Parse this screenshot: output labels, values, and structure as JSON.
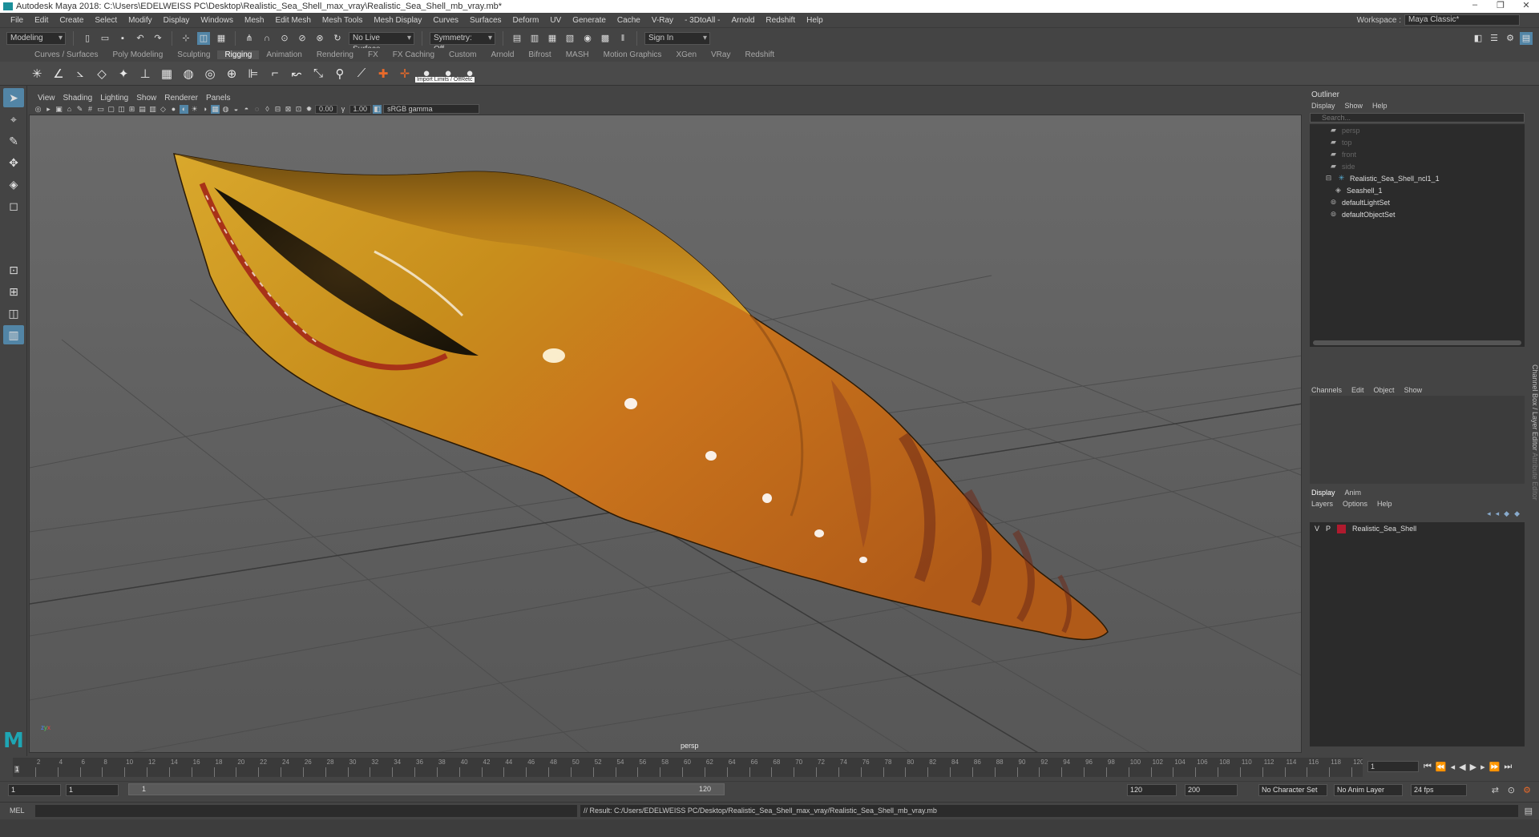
{
  "title": "Autodesk Maya 2018: C:\\Users\\EDELWEISS PC\\Desktop\\Realistic_Sea_Shell_max_vray\\Realistic_Sea_Shell_mb_vray.mb*",
  "menus": [
    "File",
    "Edit",
    "Create",
    "Select",
    "Modify",
    "Display",
    "Windows",
    "Mesh",
    "Edit Mesh",
    "Mesh Tools",
    "Mesh Display",
    "Curves",
    "Surfaces",
    "Deform",
    "UV",
    "Generate",
    "Cache",
    "V-Ray",
    "- 3DtoAll -",
    "Arnold",
    "Redshift",
    "Help"
  ],
  "workspace": {
    "label": "Workspace :",
    "value": "Maya Classic*"
  },
  "status_toolbar": {
    "mode": "Modeling",
    "live_surface": "No Live Surface",
    "symmetry": "Symmetry: Off",
    "sign_in": "Sign In"
  },
  "shelf_tabs": [
    "Curves / Surfaces",
    "Poly Modeling",
    "Sculpting",
    "Rigging",
    "Animation",
    "Rendering",
    "FX",
    "FX Caching",
    "Custom",
    "Arnold",
    "Bifrost",
    "MASH",
    "Motion Graphics",
    "XGen",
    "VRay",
    "Redshift"
  ],
  "active_shelf_tab": "Rigging",
  "shelf_tooltip": "Import Limits / OffRetc",
  "viewport": {
    "menus": [
      "View",
      "Shading",
      "Lighting",
      "Show",
      "Renderer",
      "Panels"
    ],
    "exposure": "0.00",
    "gamma": "1.00",
    "color_space": "sRGB gamma",
    "camera": "persp"
  },
  "outliner": {
    "title": "Outliner",
    "menus": [
      "Display",
      "Show",
      "Help"
    ],
    "search_placeholder": "Search...",
    "items": [
      {
        "label": "persp",
        "dim": true,
        "icon": "camera-icon"
      },
      {
        "label": "top",
        "dim": true,
        "icon": "camera-icon"
      },
      {
        "label": "front",
        "dim": true,
        "icon": "camera-icon"
      },
      {
        "label": "side",
        "dim": true,
        "icon": "camera-icon"
      },
      {
        "label": "Realistic_Sea_Shell_ncl1_1",
        "dim": false,
        "icon": "group-icon"
      },
      {
        "label": "Seashell_1",
        "dim": false,
        "icon": "mesh-icon"
      },
      {
        "label": "defaultLightSet",
        "dim": false,
        "icon": "set-icon"
      },
      {
        "label": "defaultObjectSet",
        "dim": false,
        "icon": "set-icon"
      }
    ]
  },
  "channel_box": {
    "menus": [
      "Channels",
      "Edit",
      "Object",
      "Show"
    ]
  },
  "layer_editor": {
    "tabs": [
      "Display",
      "Anim"
    ],
    "menus": [
      "Layers",
      "Options",
      "Help"
    ],
    "layers": [
      {
        "v": "V",
        "p": "P",
        "name": "Realistic_Sea_Shell",
        "color": "#b01a2e"
      }
    ]
  },
  "side_tabs": "Channel Box / Layer Editor",
  "side_tabs_2": "Attribute Editor",
  "timeline": {
    "ticks": [
      "2",
      "4",
      "6",
      "8",
      "10",
      "12",
      "14",
      "16",
      "18",
      "20",
      "22",
      "24",
      "26",
      "28",
      "30",
      "32",
      "34",
      "36",
      "38",
      "40",
      "42",
      "44",
      "46",
      "48",
      "50",
      "52",
      "54",
      "56",
      "58",
      "60",
      "62",
      "64",
      "66",
      "68",
      "70",
      "72",
      "74",
      "76",
      "78",
      "80",
      "82",
      "84",
      "86",
      "88",
      "90",
      "92",
      "94",
      "96",
      "98",
      "100",
      "102",
      "104",
      "106",
      "108",
      "110",
      "112",
      "114",
      "116",
      "118",
      "120"
    ],
    "current_frame": "1",
    "current_field": "1"
  },
  "range": {
    "start": "1",
    "start2": "1",
    "bar_start": "1",
    "bar_end": "120",
    "end": "120",
    "end2": "200",
    "char_set": "No Character Set",
    "anim_layer": "No Anim Layer",
    "fps": "24 fps"
  },
  "command": {
    "label": "MEL",
    "result": "// Result: C:/Users/EDELWEISS PC/Desktop/Realistic_Sea_Shell_max_vray/Realistic_Sea_Shell_mb_vray.mb"
  }
}
